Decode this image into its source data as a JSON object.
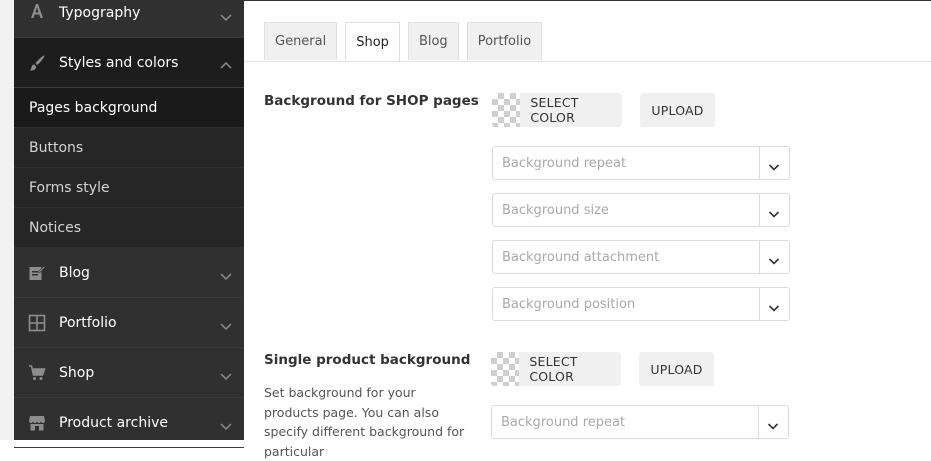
{
  "sidebar": {
    "sections_top": [
      {
        "label": "Typography",
        "icon": "typography-icon",
        "expanded": false
      },
      {
        "label": "Styles and colors",
        "icon": "brush-icon",
        "expanded": true
      }
    ],
    "subitems": [
      {
        "label": "Pages background",
        "current": true
      },
      {
        "label": "Buttons",
        "current": false
      },
      {
        "label": "Forms style",
        "current": false
      },
      {
        "label": "Notices",
        "current": false
      }
    ],
    "sections_bottom": [
      {
        "label": "Blog",
        "icon": "blog-edit-icon"
      },
      {
        "label": "Portfolio",
        "icon": "grid-icon"
      },
      {
        "label": "Shop",
        "icon": "cart-icon"
      },
      {
        "label": "Product archive",
        "icon": "store-icon"
      }
    ]
  },
  "tabs": [
    {
      "label": "General",
      "active": false
    },
    {
      "label": "Shop",
      "active": true
    },
    {
      "label": "Blog",
      "active": false
    },
    {
      "label": "Portfolio",
      "active": false
    }
  ],
  "options": {
    "shop_bg": {
      "title": "Background for SHOP pages",
      "select_color": "SELECT COLOR",
      "upload": "UPLOAD",
      "selects": [
        "Background repeat",
        "Background size",
        "Background attachment",
        "Background position"
      ]
    },
    "product_bg": {
      "title": "Single product background",
      "description": "Set background for your products page. You can also specify different background for particular",
      "select_color": "SELECT COLOR",
      "upload": "UPLOAD",
      "selects": [
        "Background repeat"
      ]
    }
  }
}
